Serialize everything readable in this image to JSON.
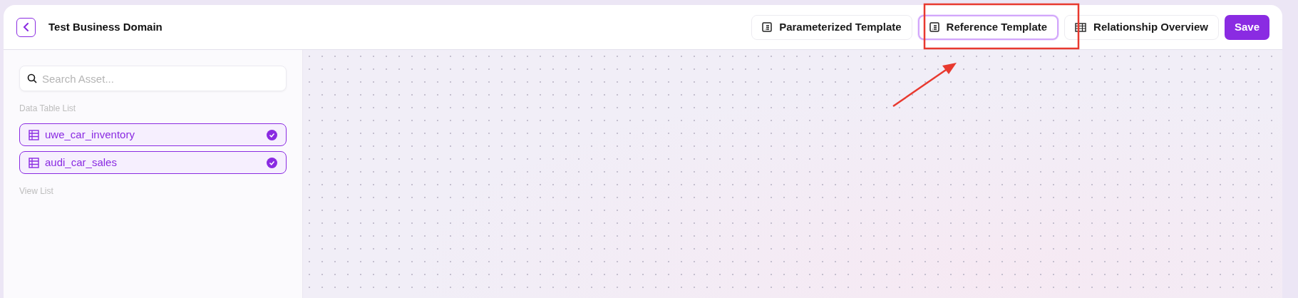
{
  "header": {
    "title": "Test Business Domain"
  },
  "tabs": [
    {
      "label": "Parameterized Template",
      "kind": "template",
      "selected": false
    },
    {
      "label": "Reference Template",
      "kind": "template",
      "selected": true
    },
    {
      "label": "Relationship Overview",
      "kind": "table",
      "selected": false
    }
  ],
  "save_button": "Save",
  "sidebar": {
    "search": {
      "placeholder": "Search Asset..."
    },
    "sections": [
      {
        "heading": "Data Table List",
        "items": [
          {
            "name": "uwe_car_inventory",
            "checked": true
          },
          {
            "name": "audi_car_sales",
            "checked": true
          }
        ]
      },
      {
        "heading": "View List"
      }
    ]
  }
}
